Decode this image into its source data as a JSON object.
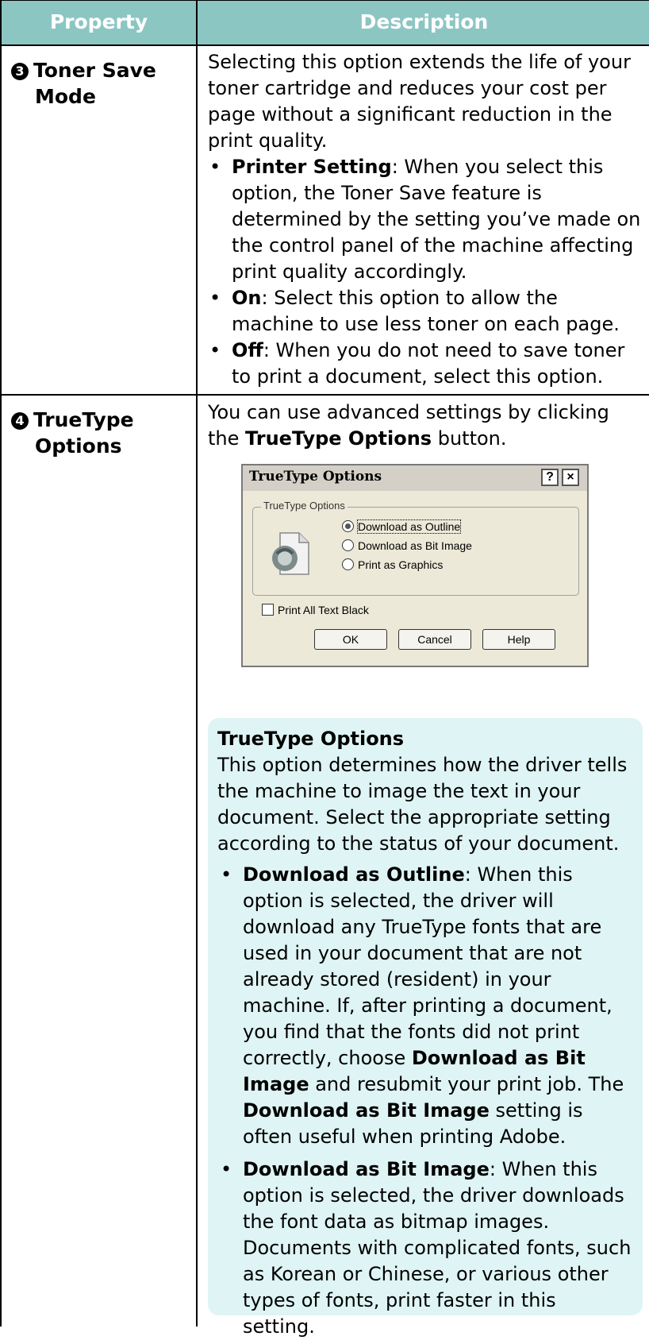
{
  "header": {
    "property": "Property",
    "description": "Description"
  },
  "rows": [
    {
      "num": "3",
      "property_line1": "Toner Save",
      "property_line2": "Mode",
      "intro": "Selecting this option extends the life of your toner cartridge and reduces your cost per page without a significant reduction in the print quality.",
      "bullets": [
        {
          "term": "Printer Setting",
          "text": ": When you select this option, the Toner Save feature is determined by the setting you’ve made on the control panel of the machine affecting print quality accordingly."
        },
        {
          "term": "On",
          "text": ": Select this option to allow the machine to use less toner on each page."
        },
        {
          "term": "Off",
          "text": ": When you do not need to save toner to print a document, select this option."
        }
      ]
    },
    {
      "num": "4",
      "property_line1": "TrueType",
      "property_line2": "Options",
      "intro_pre": "You can use advanced settings by clicking the ",
      "intro_term": "TrueType Options",
      "intro_post": " button."
    }
  ],
  "dialog": {
    "title": "TrueType Options",
    "help_glyph": "?",
    "close_glyph": "×",
    "group_label": "TrueType Options",
    "icon": "font-file-icon",
    "options": [
      "Download as Outline",
      "Download as Bit Image",
      "Print as Graphics"
    ],
    "selected_option": "Download as Outline",
    "checkbox_label": "Print All Text Black",
    "checkbox_checked": false,
    "buttons": [
      "OK",
      "Cancel",
      "Help"
    ]
  },
  "note": {
    "title": "TrueType Options",
    "intro": "This option determines how the driver tells the machine to image the text in your document. Select the appropriate setting according to the status of your document.",
    "bullet1": {
      "term": "Download as Outline",
      "text_a": ": When this option is selected, the driver will download any TrueType fonts that are used in your document that are not already stored (resident) in your machine. If, after printing a document, you find that the fonts did not print correctly, choose ",
      "term_b": "Download as Bit Image",
      "text_b": " and resubmit your print job. The ",
      "term_c": "Download as Bit Image",
      "text_c": " setting is often useful when printing Adobe."
    },
    "bullet2": {
      "term": "Download as Bit Image",
      "text": ": When this option is selected, the driver downloads the font data as bitmap images. Documents with complicated fonts, such as Korean or Chinese, or various other types of fonts, print faster in this setting."
    }
  }
}
